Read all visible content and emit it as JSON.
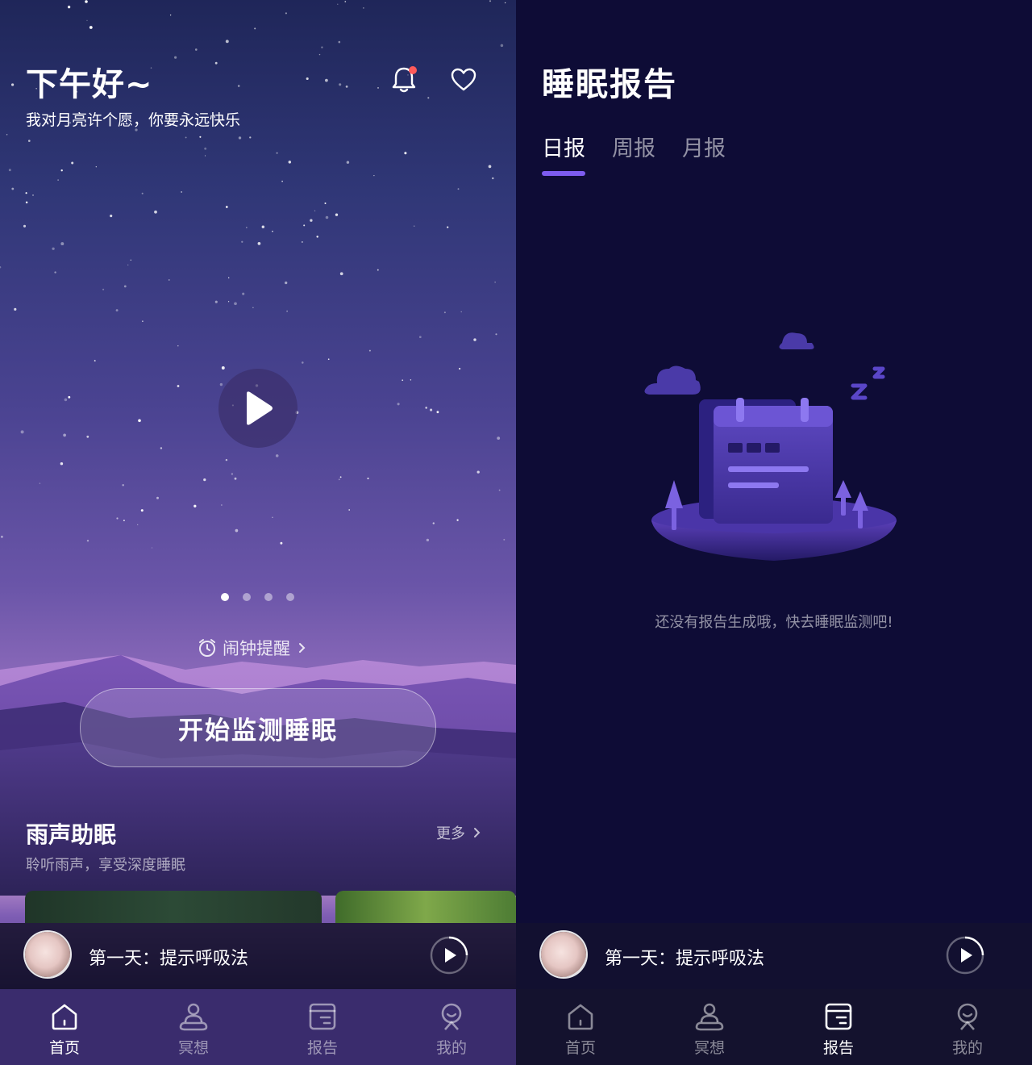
{
  "home": {
    "greeting": "下午好~",
    "subtitle": "我对月亮许个愿，你要永远快乐",
    "carousel_total": 4,
    "carousel_active": 1,
    "alarm_label": "闹钟提醒",
    "start_button": "开始监测睡眠",
    "section": {
      "title": "雨声助眠",
      "subtitle": "聆听雨声，享受深度睡眠",
      "more": "更多"
    }
  },
  "report": {
    "title": "睡眠报告",
    "tabs": [
      "日报",
      "周报",
      "月报"
    ],
    "active_tab": 0,
    "empty_message": "还没有报告生成哦，快去睡眠监测吧!"
  },
  "player": {
    "title": "第一天：提示呼吸法"
  },
  "tabbar": {
    "items": [
      {
        "label": "首页",
        "icon": "home-icon"
      },
      {
        "label": "冥想",
        "icon": "meditation-icon"
      },
      {
        "label": "报告",
        "icon": "report-icon"
      },
      {
        "label": "我的",
        "icon": "profile-icon"
      }
    ],
    "left_active": 0,
    "right_active": 2
  },
  "colors": {
    "accent": "#7d5cf0",
    "notification_dot": "#ff5a5a",
    "report_bg": "#0e0c36",
    "tabbar_bg": "#3a2c6d"
  }
}
